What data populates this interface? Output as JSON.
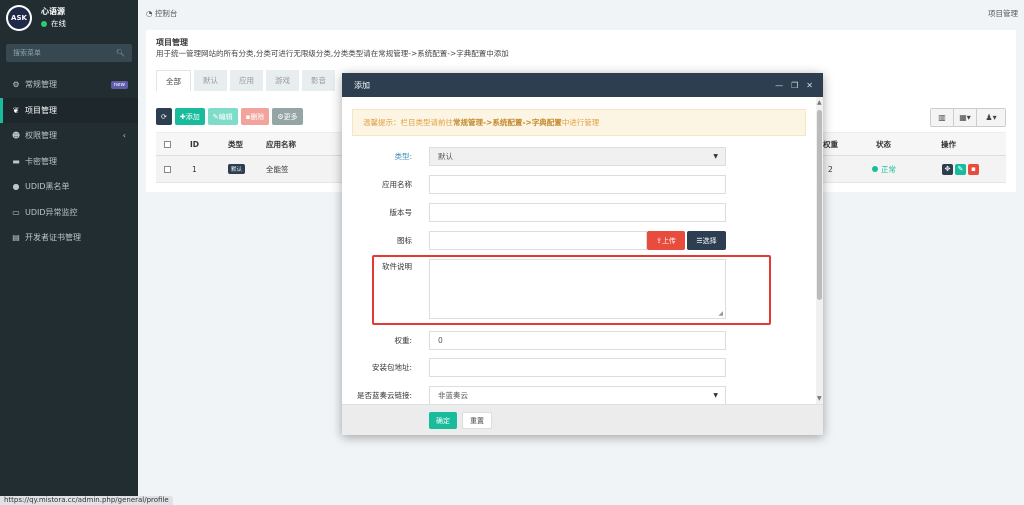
{
  "brand": {
    "logo_text": "ASK",
    "name": "心语源",
    "status": "在线"
  },
  "sidebar": {
    "search_placeholder": "搜索菜单",
    "items": [
      {
        "label": "常规管理",
        "badge": "new",
        "icon": "gears-icon"
      },
      {
        "label": "项目管理",
        "icon": "leaf-icon",
        "active": true
      },
      {
        "label": "权限管理",
        "icon": "group-icon",
        "chevron": "‹"
      },
      {
        "label": "卡密管理",
        "icon": "card-icon"
      },
      {
        "label": "UDID黑名单",
        "icon": "bomb-icon"
      },
      {
        "label": "UDID异常监控",
        "icon": "monitor-icon"
      },
      {
        "label": "开发者证书管理",
        "icon": "certificate-icon"
      }
    ]
  },
  "topbar": {
    "breadcrumb": "控制台",
    "right_title": "项目管理"
  },
  "page": {
    "title": "项目管理",
    "description": "用于统一管理网站的所有分类,分类可进行无限级分类,分类类型请在常规管理->系统配置->字典配置中添加",
    "tabs": [
      "全部",
      "默认",
      "应用",
      "游戏",
      "影音"
    ]
  },
  "toolbar": {
    "add": "添加",
    "edit": "编辑",
    "delete": "删除",
    "more": "更多"
  },
  "table": {
    "headers": {
      "id": "ID",
      "type": "类型",
      "name": "应用名称",
      "weight": "权重",
      "status": "状态",
      "ops": "操作"
    },
    "rows": [
      {
        "id": "1",
        "type": "默认",
        "name": "全能签",
        "weight": "2",
        "status": "正常"
      }
    ]
  },
  "modal": {
    "title": "添加",
    "tip_prefix": "温馨提示：栏目类型请前往",
    "tip_link1": "常规管理",
    "tip_sep1": "->",
    "tip_link2": "系统配置",
    "tip_sep2": "->",
    "tip_link3": "字典配置",
    "tip_suffix": "中进行管理",
    "fields": {
      "type_label": "类型:",
      "type_value": "默认",
      "name_label": "应用名称",
      "version_label": "版本号",
      "icon_label": "图标",
      "upload": "上传",
      "choose": "选择",
      "desc_label": "软件说明",
      "weight_label": "权重:",
      "weight_value": "0",
      "package_label": "安装包地址:",
      "lanzou_label": "是否蓝奏云链接:",
      "lanzou_value": "非蓝奏云"
    },
    "ok": "确定",
    "reset": "重置"
  },
  "status_url": "https://qy.mistora.cc/admin.php/general/profile",
  "colors": {
    "sidebar": "#222d32",
    "accent": "#18bc9c",
    "header": "#2c3e50",
    "danger": "#e74c3c",
    "highlight": "#e53935"
  }
}
